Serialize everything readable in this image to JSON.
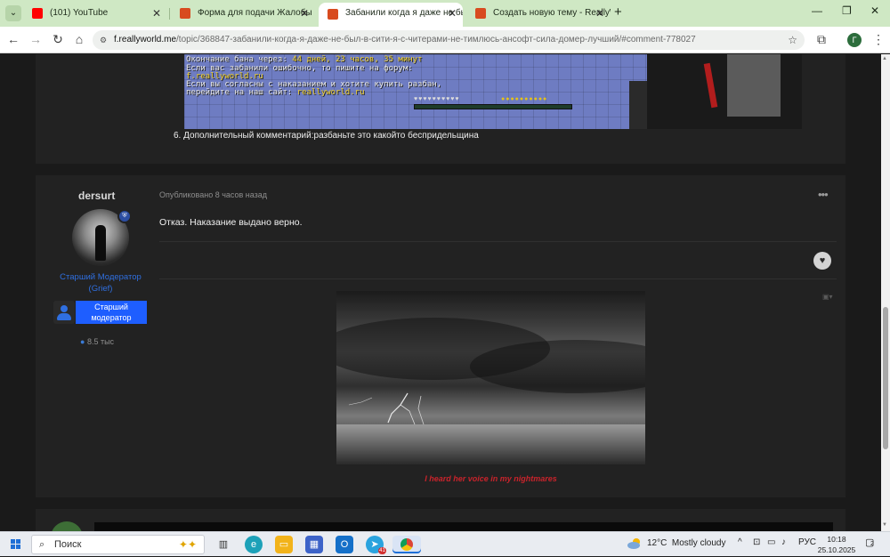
{
  "browser": {
    "tabs": [
      {
        "title": "(101) YouTube",
        "favicon_color": "#ff0000"
      },
      {
        "title": "Форма для подачи Жалобы на",
        "favicon_color": "#d84b1f"
      },
      {
        "title": "Забанили когда я даже не был",
        "favicon_color": "#d84b1f"
      },
      {
        "title": "Создать новую тему - ReallyW",
        "favicon_color": "#d84b1f"
      }
    ],
    "new_tab": "+",
    "url_host": "f.reallyworld.me",
    "url_path": "/topic/368847-забанили-когда-я-даже-не-был-в-сити-я-с-читерами-не-тимлюсь-ансофт-сила-домер-лучший/#comment-778027",
    "profile_initial": "Г"
  },
  "post1": {
    "minecraft_lines": [
      {
        "text": "Окончание бана через: ",
        "accent": "44 дней, 23 часов, 35 минут"
      },
      {
        "text": "Если вас забанили ошибочно, то пишите на форум:",
        "accent": ""
      },
      {
        "text": " ",
        "accent": "f.reallyworld.ru"
      },
      {
        "text": "Если вы согласны с наказанием и хотите купить разбан,",
        "accent": ""
      },
      {
        "text": " перейдите на наш сайт: ",
        "accent": "reallyworld.ru"
      }
    ],
    "hearts": "♥♥♥♥♥♥♥♥♥♥",
    "food": "●●●●●●●●●●",
    "comment": "6. Дополнительный комментарий:разбаньте это какойто беспридельщина"
  },
  "post2": {
    "author": "dersurt",
    "rank": "Старший Модератор (Grief)",
    "group": "Старший модератор",
    "reputation": "8.5 тыс",
    "published": "Опубликовано 8 часов назад",
    "menu": "•••",
    "text": "Отказ. Наказание выдано верно.",
    "like_icon": "heart-icon",
    "signature": "I heard her voice in my nightmares"
  },
  "taskbar": {
    "search_placeholder": "Поиск",
    "weather_temp": "12°C",
    "weather_desc": "Mostly cloudy",
    "language": "РУС",
    "time": "10:18",
    "date": "25.10.2025",
    "notifications": "2",
    "telegram_badge": "41"
  }
}
